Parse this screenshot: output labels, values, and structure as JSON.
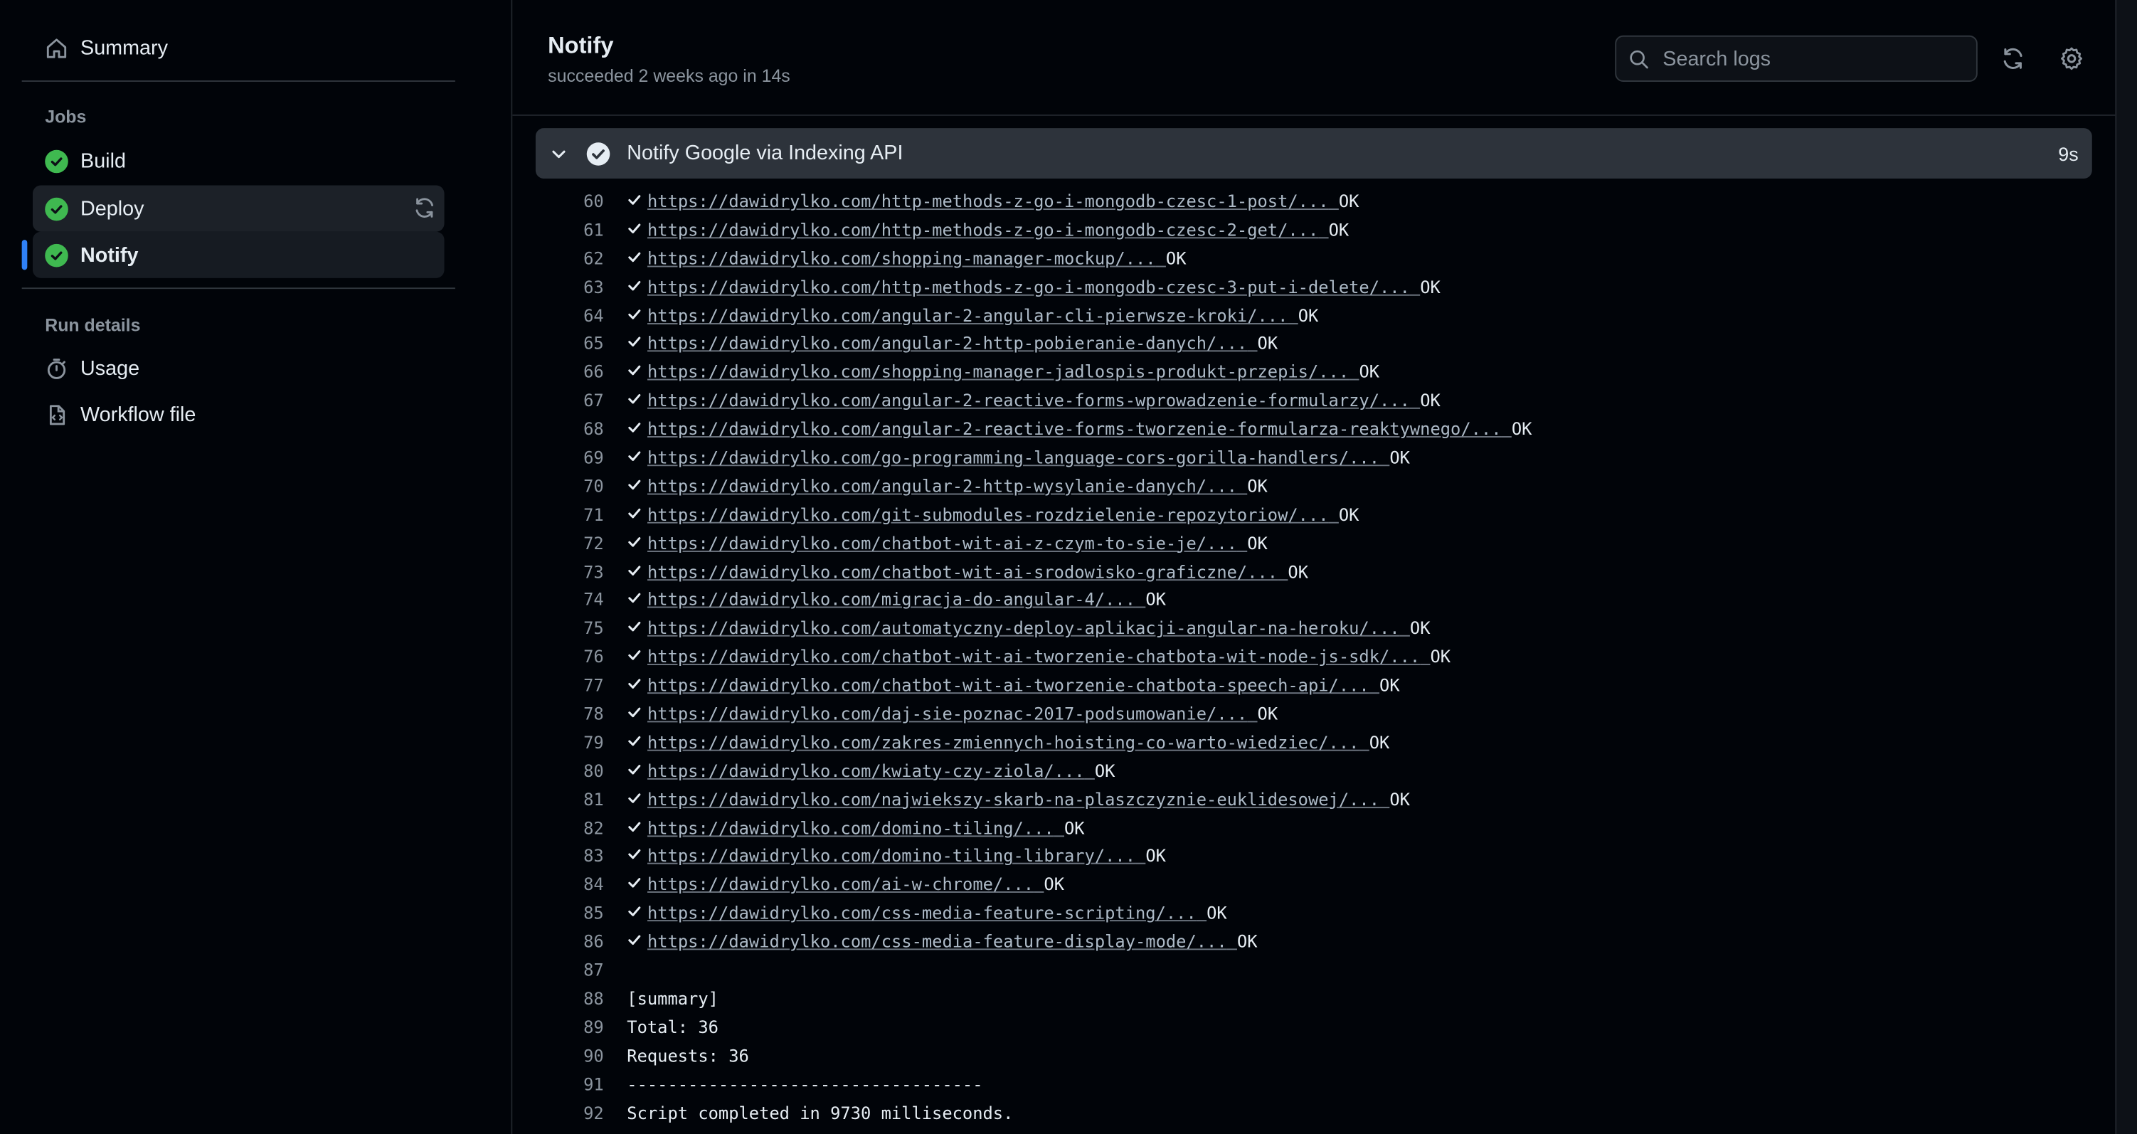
{
  "sidebar": {
    "summary_label": "Summary",
    "jobs_title": "Jobs",
    "jobs": [
      {
        "label": "Build",
        "status": "success"
      },
      {
        "label": "Deploy",
        "status": "success"
      },
      {
        "label": "Notify",
        "status": "success"
      }
    ],
    "run_details_title": "Run details",
    "usage_label": "Usage",
    "workflow_file_label": "Workflow file"
  },
  "header": {
    "title": "Notify",
    "subtitle": "succeeded 2 weeks ago in 14s",
    "search_placeholder": "Search logs"
  },
  "step": {
    "title": "Notify Google via Indexing API",
    "duration": "9s"
  },
  "log": {
    "url_lines": [
      {
        "n": "60",
        "url": "https://dawidrylko.com/http-methods-z-go-i-mongodb-czesc-1-post/...",
        "status": "OK"
      },
      {
        "n": "61",
        "url": "https://dawidrylko.com/http-methods-z-go-i-mongodb-czesc-2-get/...",
        "status": "OK"
      },
      {
        "n": "62",
        "url": "https://dawidrylko.com/shopping-manager-mockup/...",
        "status": "OK"
      },
      {
        "n": "63",
        "url": "https://dawidrylko.com/http-methods-z-go-i-mongodb-czesc-3-put-i-delete/...",
        "status": "OK"
      },
      {
        "n": "64",
        "url": "https://dawidrylko.com/angular-2-angular-cli-pierwsze-kroki/...",
        "status": "OK"
      },
      {
        "n": "65",
        "url": "https://dawidrylko.com/angular-2-http-pobieranie-danych/...",
        "status": "OK"
      },
      {
        "n": "66",
        "url": "https://dawidrylko.com/shopping-manager-jadlospis-produkt-przepis/...",
        "status": "OK"
      },
      {
        "n": "67",
        "url": "https://dawidrylko.com/angular-2-reactive-forms-wprowadzenie-formularzy/...",
        "status": "OK"
      },
      {
        "n": "68",
        "url": "https://dawidrylko.com/angular-2-reactive-forms-tworzenie-formularza-reaktywnego/...",
        "status": "OK"
      },
      {
        "n": "69",
        "url": "https://dawidrylko.com/go-programming-language-cors-gorilla-handlers/...",
        "status": "OK"
      },
      {
        "n": "70",
        "url": "https://dawidrylko.com/angular-2-http-wysylanie-danych/...",
        "status": "OK"
      },
      {
        "n": "71",
        "url": "https://dawidrylko.com/git-submodules-rozdzielenie-repozytoriow/...",
        "status": "OK"
      },
      {
        "n": "72",
        "url": "https://dawidrylko.com/chatbot-wit-ai-z-czym-to-sie-je/...",
        "status": "OK"
      },
      {
        "n": "73",
        "url": "https://dawidrylko.com/chatbot-wit-ai-srodowisko-graficzne/...",
        "status": "OK"
      },
      {
        "n": "74",
        "url": "https://dawidrylko.com/migracja-do-angular-4/...",
        "status": "OK"
      },
      {
        "n": "75",
        "url": "https://dawidrylko.com/automatyczny-deploy-aplikacji-angular-na-heroku/...",
        "status": "OK"
      },
      {
        "n": "76",
        "url": "https://dawidrylko.com/chatbot-wit-ai-tworzenie-chatbota-wit-node-js-sdk/...",
        "status": "OK"
      },
      {
        "n": "77",
        "url": "https://dawidrylko.com/chatbot-wit-ai-tworzenie-chatbota-speech-api/...",
        "status": "OK"
      },
      {
        "n": "78",
        "url": "https://dawidrylko.com/daj-sie-poznac-2017-podsumowanie/...",
        "status": "OK"
      },
      {
        "n": "79",
        "url": "https://dawidrylko.com/zakres-zmiennych-hoisting-co-warto-wiedziec/...",
        "status": "OK"
      },
      {
        "n": "80",
        "url": "https://dawidrylko.com/kwiaty-czy-ziola/...",
        "status": "OK"
      },
      {
        "n": "81",
        "url": "https://dawidrylko.com/najwiekszy-skarb-na-plaszczyznie-euklidesowej/...",
        "status": "OK"
      },
      {
        "n": "82",
        "url": "https://dawidrylko.com/domino-tiling/...",
        "status": "OK"
      },
      {
        "n": "83",
        "url": "https://dawidrylko.com/domino-tiling-library/...",
        "status": "OK"
      },
      {
        "n": "84",
        "url": "https://dawidrylko.com/ai-w-chrome/...",
        "status": "OK"
      },
      {
        "n": "85",
        "url": "https://dawidrylko.com/css-media-feature-scripting/...",
        "status": "OK"
      },
      {
        "n": "86",
        "url": "https://dawidrylko.com/css-media-feature-display-mode/...",
        "status": "OK"
      }
    ],
    "text_lines": [
      {
        "n": "87",
        "text": ""
      },
      {
        "n": "88",
        "text": "[summary]"
      },
      {
        "n": "89",
        "text": "Total: 36"
      },
      {
        "n": "90",
        "text": "Requests: 36"
      },
      {
        "n": "91",
        "text": "-----------------------------------"
      },
      {
        "n": "92",
        "text": "Script completed in 9730 milliseconds."
      }
    ]
  },
  "colors": {
    "success": "#3fb950",
    "accent": "#2f81f7",
    "background": "#010409"
  },
  "icons": {
    "summary": "home-icon",
    "usage": "stopwatch-icon",
    "workflow": "file-code-icon",
    "search": "search-icon",
    "refresh": "sync-icon",
    "settings": "gear-icon"
  }
}
